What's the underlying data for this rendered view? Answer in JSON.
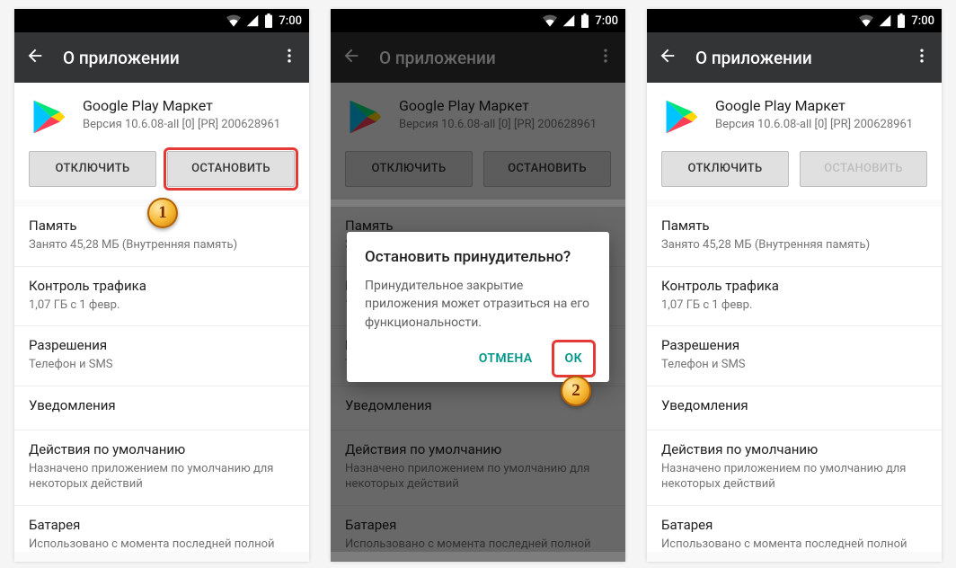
{
  "status": {
    "time": "7:00"
  },
  "appbar": {
    "title": "О приложении"
  },
  "app": {
    "name": "Google Play Маркет",
    "version": "Версия 10.6.08-all [0] [PR] 200628961"
  },
  "buttons": {
    "disable": "ОТКЛЮЧИТЬ",
    "stop": "ОСТАНОВИТЬ"
  },
  "rows": {
    "memory_title": "Память",
    "memory_sub": "Занято 45,28  МБ (Внутренняя память)",
    "data_title": "Контроль трафика",
    "data_sub": "1,07  ГБ с 1 февр.",
    "perms_title": "Разрешения",
    "perms_sub": "Телефон и SMS",
    "notif_title": "Уведомления",
    "defaults_title": "Действия по умолчанию",
    "defaults_sub": "Назначено приложением по умолчанию для некоторых действий",
    "battery_title": "Батарея",
    "battery_sub": "Использовано с момента последней полной"
  },
  "dialog": {
    "title": "Остановить принудительно?",
    "body": "Принудительное закрытие приложения может отразиться на его функциональности.",
    "cancel": "ОТМЕНА",
    "ok": "ОК"
  },
  "markers": {
    "one": "1",
    "two": "2"
  }
}
